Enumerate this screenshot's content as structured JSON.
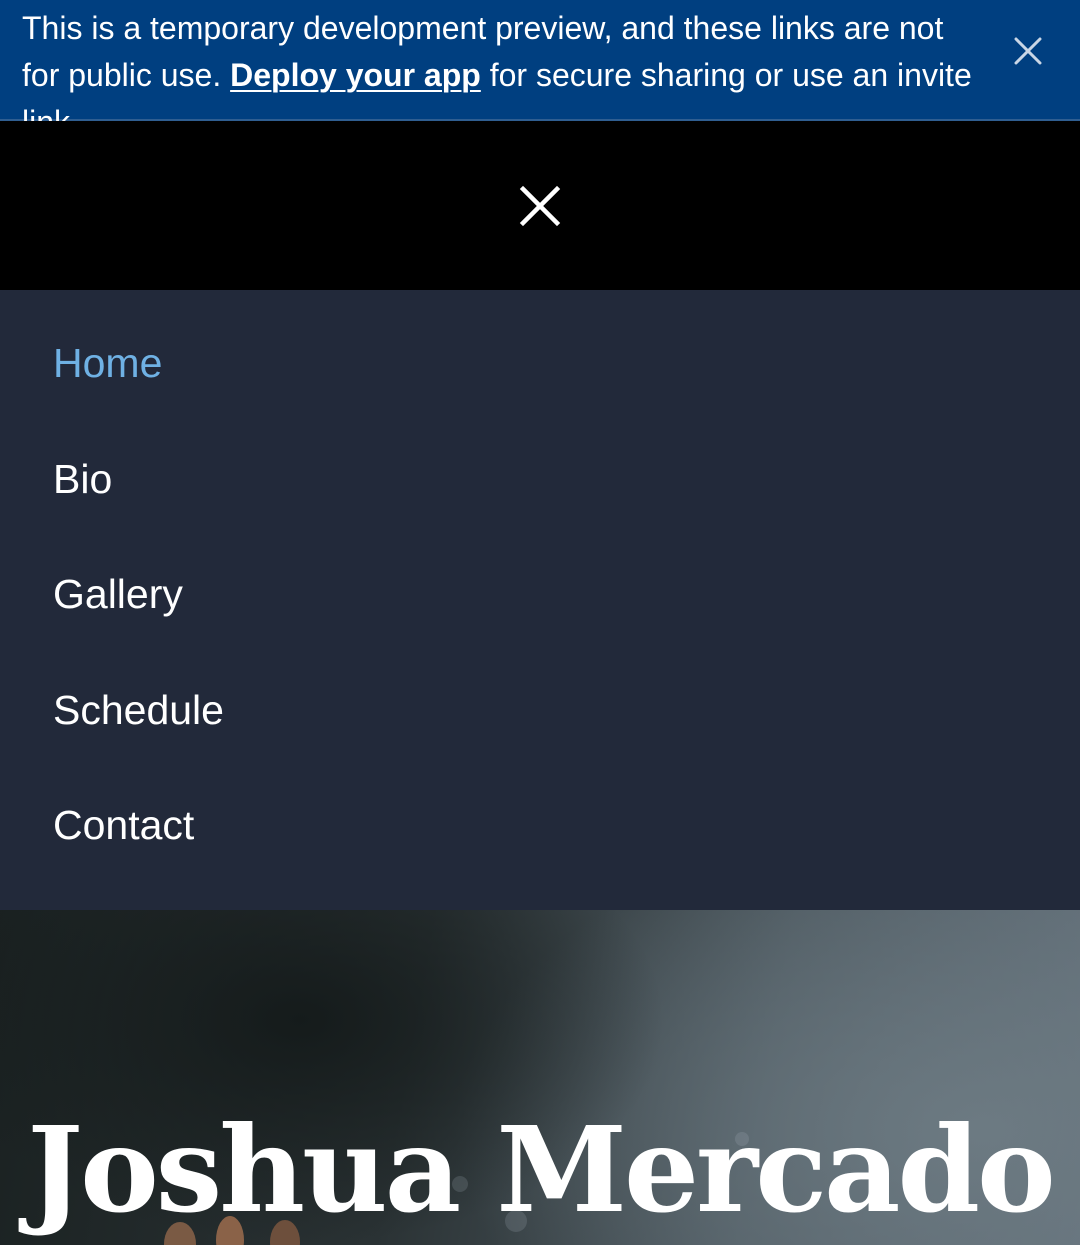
{
  "banner": {
    "text_before": "This is a temporary development preview, and these links are not for public use. ",
    "link_label": "Deploy your app",
    "text_after": " for secure sharing or use an invite link.",
    "close_icon": "close-icon",
    "background_color": "#003f80"
  },
  "header": {
    "menu_close_icon": "close-icon",
    "background_color": "#000000"
  },
  "nav": {
    "background_color": "#22293a",
    "active_color": "#6fb1e4",
    "items": [
      {
        "label": "Home",
        "active": true
      },
      {
        "label": "Bio",
        "active": false
      },
      {
        "label": "Gallery",
        "active": false
      },
      {
        "label": "Schedule",
        "active": false
      },
      {
        "label": "Contact",
        "active": false
      }
    ]
  },
  "hero": {
    "title": "Joshua Mercado"
  }
}
